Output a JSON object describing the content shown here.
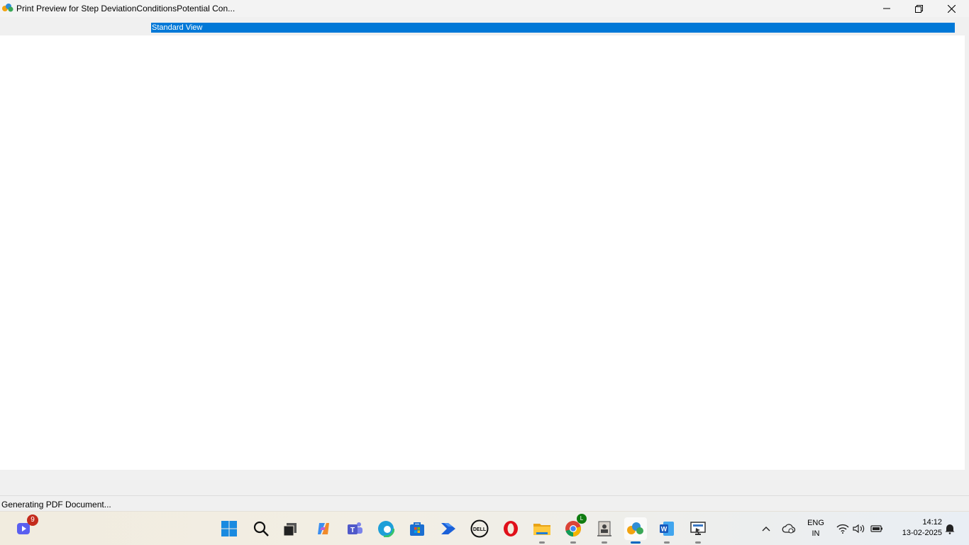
{
  "window": {
    "title": "Print Preview for Step DeviationConditionsPotential Con...",
    "controls": {
      "minimize": "minimize-icon",
      "maximize": "restore-icon",
      "close": "close-icon"
    }
  },
  "view_selector": {
    "selected": "Standard View"
  },
  "status": {
    "text": "Generating PDF Document..."
  },
  "taskbar": {
    "items": [
      {
        "name": "notifications-app-icon",
        "badge": "9"
      },
      {
        "name": "windows-start-icon"
      },
      {
        "name": "search-icon"
      },
      {
        "name": "task-view-icon"
      },
      {
        "name": "copilot-icon"
      },
      {
        "name": "teams-icon"
      },
      {
        "name": "edge-icon"
      },
      {
        "name": "microsoft-store-icon"
      },
      {
        "name": "power-automate-icon"
      },
      {
        "name": "dell-icon"
      },
      {
        "name": "opera-icon"
      },
      {
        "name": "file-explorer-icon"
      },
      {
        "name": "chrome-icon",
        "badge": "L"
      },
      {
        "name": "contacts-app-icon"
      },
      {
        "name": "print-preview-app-icon",
        "active": true
      },
      {
        "name": "word-icon"
      },
      {
        "name": "remote-app-icon"
      }
    ],
    "tray": {
      "language": "ENG",
      "region": "IN",
      "time": "14:12",
      "date": "13-02-2025"
    }
  },
  "colors": {
    "selection": "#0078d7",
    "status_badge": "#c42b1c",
    "chrome_badge": "#107c10",
    "active_indicator": "#0067c0"
  }
}
